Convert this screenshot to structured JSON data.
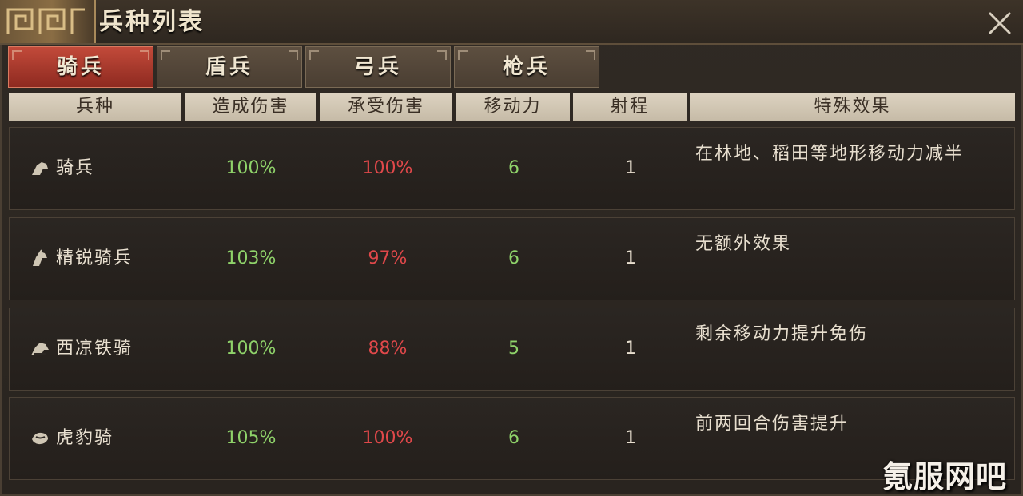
{
  "window": {
    "title": "兵种列表",
    "close_icon": "close-icon"
  },
  "tabs": [
    {
      "label": "骑兵",
      "active": true
    },
    {
      "label": "盾兵",
      "active": false
    },
    {
      "label": "弓兵",
      "active": false
    },
    {
      "label": "枪兵",
      "active": false
    }
  ],
  "table": {
    "headers": [
      "兵种",
      "造成伤害",
      "承受伤害",
      "移动力",
      "射程",
      "特殊效果"
    ],
    "rows": [
      {
        "icon": "horse-head-icon",
        "name": "骑兵",
        "damage_dealt": "100%",
        "damage_taken": "100%",
        "movement": "6",
        "range": "1",
        "effect": "在林地、稻田等地形移动力减半"
      },
      {
        "icon": "elite-horse-icon",
        "name": "精锐骑兵",
        "damage_dealt": "103%",
        "damage_taken": "97%",
        "movement": "6",
        "range": "1",
        "effect": "无额外效果"
      },
      {
        "icon": "armored-horse-icon",
        "name": "西凉铁骑",
        "damage_dealt": "100%",
        "damage_taken": "88%",
        "movement": "5",
        "range": "1",
        "effect": "剩余移动力提升免伤"
      },
      {
        "icon": "tiger-leopard-icon",
        "name": "虎豹骑",
        "damage_dealt": "105%",
        "damage_taken": "100%",
        "movement": "6",
        "range": "1",
        "effect": "前两回合伤害提升"
      }
    ]
  },
  "watermark": "氪服网吧",
  "colors": {
    "positive": "#8fd36a",
    "negative": "#e0484a",
    "active_tab": "#c24a3a"
  }
}
